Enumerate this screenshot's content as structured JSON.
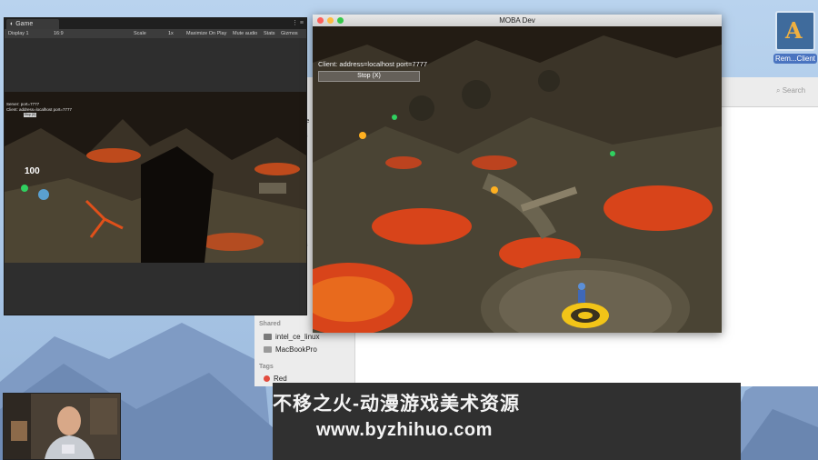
{
  "desktop": {
    "icon_label": "Rem...Client"
  },
  "unity": {
    "tab_title": "Game",
    "display": "Display 1",
    "aspect": "16:9",
    "scale": "Scale",
    "scale_value": "1x",
    "maximize": "Maximize On Play",
    "mute": "Mute audio",
    "stats": "Stats",
    "gizmos": "Gizmos",
    "hud_server": "Server: port=7777",
    "hud_client": "Client: address=localhost port=7777",
    "hud_stop": "Stop (X)",
    "health": "100"
  },
  "moba": {
    "title": "MOBA Dev",
    "client_text": "Client: address=localhost port=7777",
    "stop_button": "Stop (X)"
  },
  "finder": {
    "search_placeholder": "Search",
    "shared_heading": "Shared",
    "shared_items": [
      "intel_ce_linux",
      "MacBookPro"
    ],
    "tags_heading": "Tags",
    "tag_items": [
      "Red"
    ],
    "fragments": [
      "ve",
      "ts",
      "iv",
      "D",
      "s",
      "s",
      "ts"
    ]
  },
  "watermark": {
    "line1": "不移之火-动漫游戏美术资源",
    "line2": "www.byzhihuo.com"
  },
  "colors": {
    "lava": "#e0501a",
    "lava_glow": "#ffb020",
    "stone": "#4b4a3a",
    "tag_red": "#e24b3e"
  }
}
